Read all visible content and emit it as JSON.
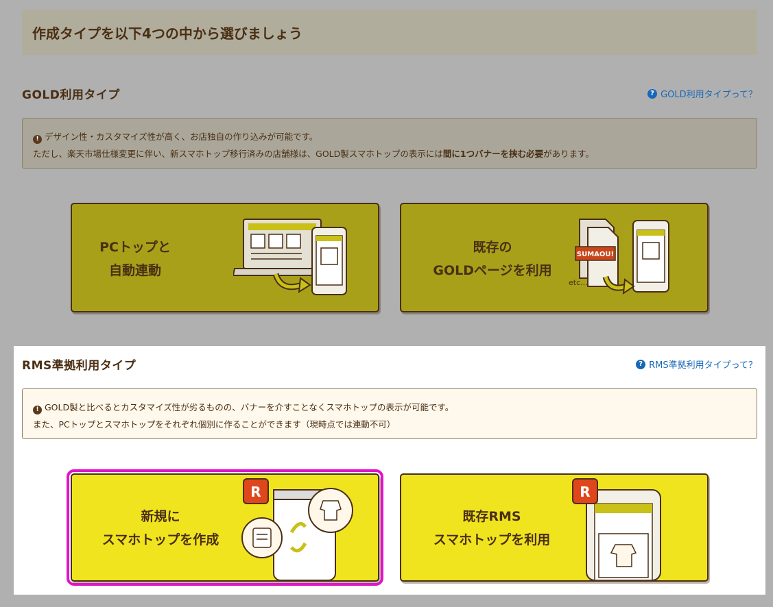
{
  "header": {
    "title": "作成タイプを以下4つの中から選びましょう"
  },
  "gold": {
    "title": "GOLD利用タイプ",
    "help_link": "GOLD利用タイプって？",
    "notice_line1": "デザイン性・カスタマイズ性が高く、お店独自の作り込みが可能です。",
    "notice_line2_pre": "ただし、楽天市場仕様変更に伴い、新スマホトップ移行済みの店舗様は、GOLD製スマホトップの表示には",
    "notice_line2_bold": "間に1つバナーを挟む必要",
    "notice_line2_post": "があります。",
    "cards": [
      {
        "line1": "PCトップと",
        "line2": "自動連動"
      },
      {
        "line1": "既存の",
        "line2": "GOLDページを利用",
        "badge": "SUMAOU!",
        "etc": "etc..."
      }
    ]
  },
  "rms": {
    "title": "RMS準拠利用タイプ",
    "help_link": "RMS準拠利用タイプって？",
    "notice_line1": "GOLD製と比べるとカスタマイズ性が劣るものの、バナーを介すことなくスマホトップの表示が可能です。",
    "notice_line2": "また、PCトップとスマホトップをそれぞれ個別に作ることができます（現時点では連動不可）",
    "cards": [
      {
        "line1": "新規に",
        "line2": "スマホトップを作成",
        "r_badge": "R"
      },
      {
        "line1": "既存RMS",
        "line2": "スマホトップを利用",
        "r_badge": "R"
      }
    ]
  },
  "colors": {
    "gold_card": "#a8a019",
    "rms_card": "#f0e41f",
    "selected_outline": "#e014c8",
    "link": "#1868b8",
    "text": "#4a2f14"
  },
  "icons": {
    "help": "question-circle-icon",
    "info": "exclamation-circle-icon"
  }
}
